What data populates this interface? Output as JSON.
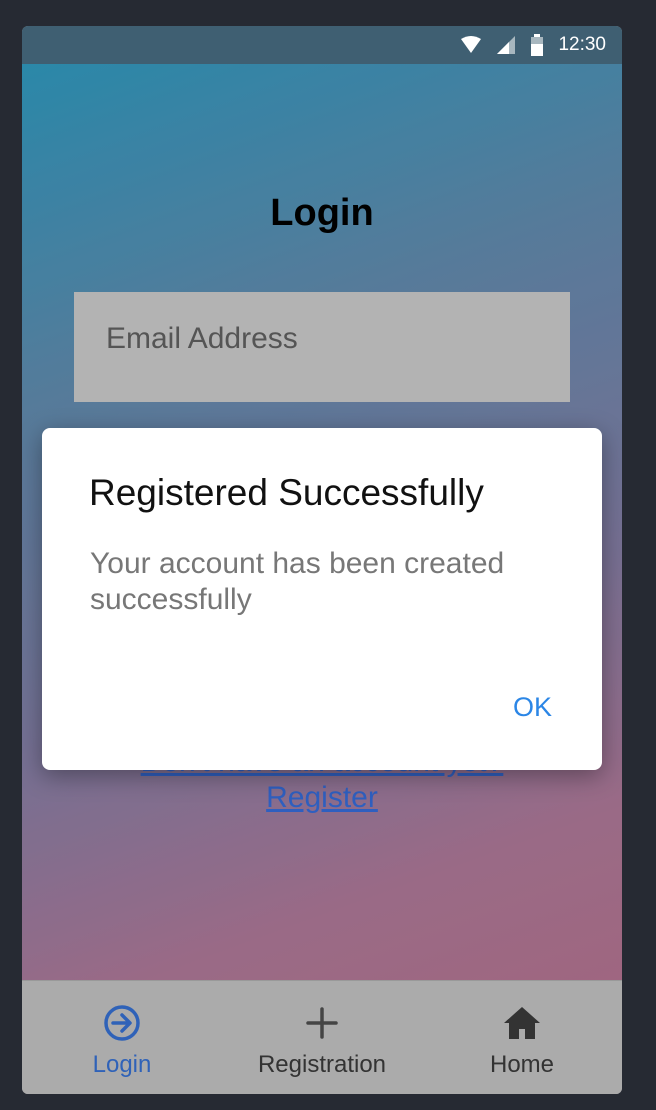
{
  "status_bar": {
    "time": "12:30",
    "icons": [
      "wifi-icon",
      "signal-icon",
      "battery-icon"
    ]
  },
  "login": {
    "title": "Login",
    "email_placeholder": "Email Address",
    "register_link_line1": "Don't have an account yet?",
    "register_link_line2": "Register"
  },
  "dialog": {
    "title": "Registered Successfully",
    "message": "Your account has been created successfully",
    "ok_label": "OK"
  },
  "bottom_nav": {
    "items": [
      {
        "label": "Login",
        "icon": "login-arrow-icon",
        "active": true
      },
      {
        "label": "Registration",
        "icon": "plus-icon",
        "active": false
      },
      {
        "label": "Home",
        "icon": "home-icon",
        "active": false
      }
    ]
  },
  "colors": {
    "accent": "#2f62b8",
    "dialog_button": "#2b86e6",
    "link": "#2f5fbf"
  }
}
